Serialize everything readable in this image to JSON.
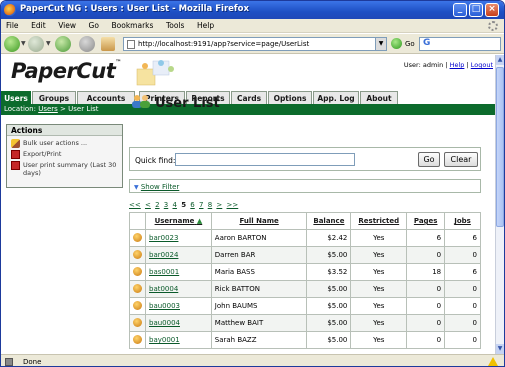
{
  "window": {
    "title": "PaperCut NG : Users : User List - Mozilla Firefox"
  },
  "menu": [
    "File",
    "Edit",
    "View",
    "Go",
    "Bookmarks",
    "Tools",
    "Help"
  ],
  "nav": {
    "url": "http://localhost:9191/app?service=page/UserList",
    "go_label": "Go",
    "search_value": "G"
  },
  "app": {
    "logo": "PaperCut",
    "logo_tm": "™",
    "user_prefix": "User: admin |",
    "help_link": "Help",
    "logout_link": "Logout",
    "tabs": [
      "Users",
      "Groups",
      "Accounts",
      "Printers",
      "Reports",
      "Cards",
      "Options",
      "App. Log",
      "About"
    ],
    "active_tab": "Users",
    "location": {
      "prefix": "Location:",
      "link": "Users",
      "rest": "> User List"
    }
  },
  "actions": {
    "title": "Actions",
    "items": [
      "Bulk user actions ...",
      "Export/Print",
      "User print summary (Last 30 days)"
    ]
  },
  "page": {
    "title": "User List",
    "quick_find_label": "Quick find:",
    "quick_find_value": "",
    "go_button": "Go",
    "clear_button": "Clear",
    "show_filter": "Show Filter",
    "pager": {
      "prev": [
        "<<",
        "<"
      ],
      "pages": [
        "2",
        "3",
        "4",
        "5",
        "6",
        "7",
        "8"
      ],
      "current": "5",
      "next": [
        ">",
        ">>"
      ]
    }
  },
  "table": {
    "headers": {
      "username": "Username",
      "fullname": "Full Name",
      "balance": "Balance",
      "restricted": "Restricted",
      "pages": "Pages",
      "jobs": "Jobs"
    },
    "sort_indicator": "▲",
    "rows": [
      {
        "username": "bar0023",
        "fullname": "Aaron BARTON",
        "balance": "$2.42",
        "restricted": "Yes",
        "pages": "6",
        "jobs": "6"
      },
      {
        "username": "bar0024",
        "fullname": "Darren BAR",
        "balance": "$5.00",
        "restricted": "Yes",
        "pages": "0",
        "jobs": "0"
      },
      {
        "username": "bas0001",
        "fullname": "Maria BASS",
        "balance": "$3.52",
        "restricted": "Yes",
        "pages": "18",
        "jobs": "6"
      },
      {
        "username": "bat0004",
        "fullname": "Rick BATTON",
        "balance": "$5.00",
        "restricted": "Yes",
        "pages": "0",
        "jobs": "0"
      },
      {
        "username": "bau0003",
        "fullname": "John BAUMS",
        "balance": "$5.00",
        "restricted": "Yes",
        "pages": "0",
        "jobs": "0"
      },
      {
        "username": "bau0004",
        "fullname": "Matthew BAIT",
        "balance": "$5.00",
        "restricted": "Yes",
        "pages": "0",
        "jobs": "0"
      },
      {
        "username": "bay0001",
        "fullname": "Sarah BAZZ",
        "balance": "$5.00",
        "restricted": "Yes",
        "pages": "0",
        "jobs": "0"
      }
    ]
  },
  "status": {
    "text": "Done"
  }
}
